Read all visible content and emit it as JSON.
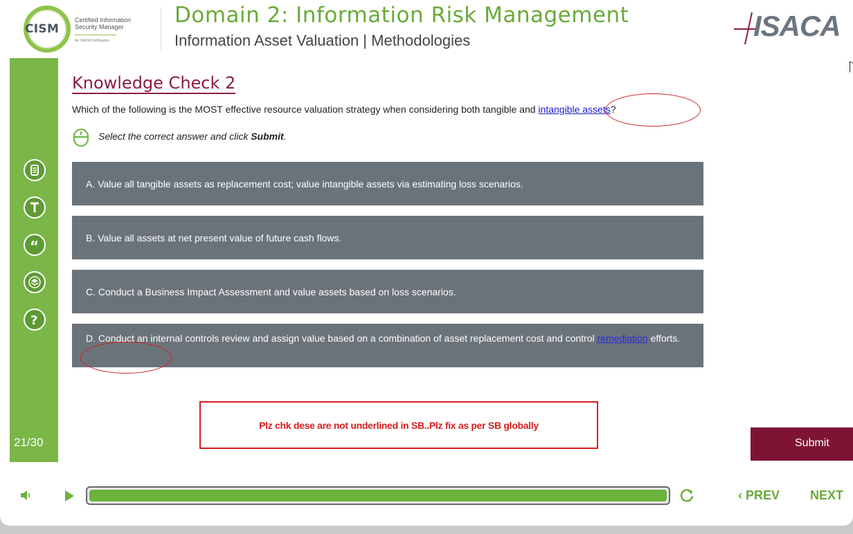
{
  "header": {
    "badge_text": "CISM",
    "cert_line1": "Certified Information",
    "cert_line2": "Security Manager",
    "cert_sub": "An ISACA Certification",
    "course_title": "Domain 2: Information Risk Management",
    "course_subtitle": "Information Asset Valuation | Methodologies",
    "logo_text": "ISACA"
  },
  "sidebar": {
    "icons": [
      "notes-icon",
      "transcript-icon",
      "quote-icon",
      "layers-icon",
      "help-icon"
    ],
    "icon_glyphs": [
      "☰",
      "T",
      "“",
      "≡",
      "?"
    ],
    "page_counter": "21/30"
  },
  "content": {
    "title": "Knowledge Check 2",
    "question_before": "Which of the following is the MOST effective resource valuation strategy when considering both tangible and ",
    "question_link": "intangible assets",
    "question_after": "?",
    "instruction_before": "Select the correct answer and click ",
    "instruction_bold": "Submit",
    "instruction_after": ".",
    "options": [
      {
        "text": "A.  Value all tangible assets as replacement cost; value intangible assets via estimating loss scenarios."
      },
      {
        "text": "B.  Value all assets at net present value of future cash flows."
      },
      {
        "text": "C.  Conduct a Business Impact Assessment and value assets based on loss scenarios."
      },
      {
        "text_before": "D.  Conduct an internal controls review and assign value based on a combination of asset replacement cost and control ",
        "link": "remediation",
        "text_after": " efforts."
      }
    ],
    "review_note": "Plz chk dese are not underlined in SB..Plz fix as per SB globally",
    "submit_label": "Submit"
  },
  "player": {
    "progress": 1.0,
    "prev_label": "PREV",
    "next_label": "NEXT",
    "prev_glyph": "‹",
    "colors": {
      "green": "#6bb33c",
      "maroon": "#7e1434",
      "option_bg": "#6b737a",
      "annotation_red": "#d42020"
    }
  }
}
